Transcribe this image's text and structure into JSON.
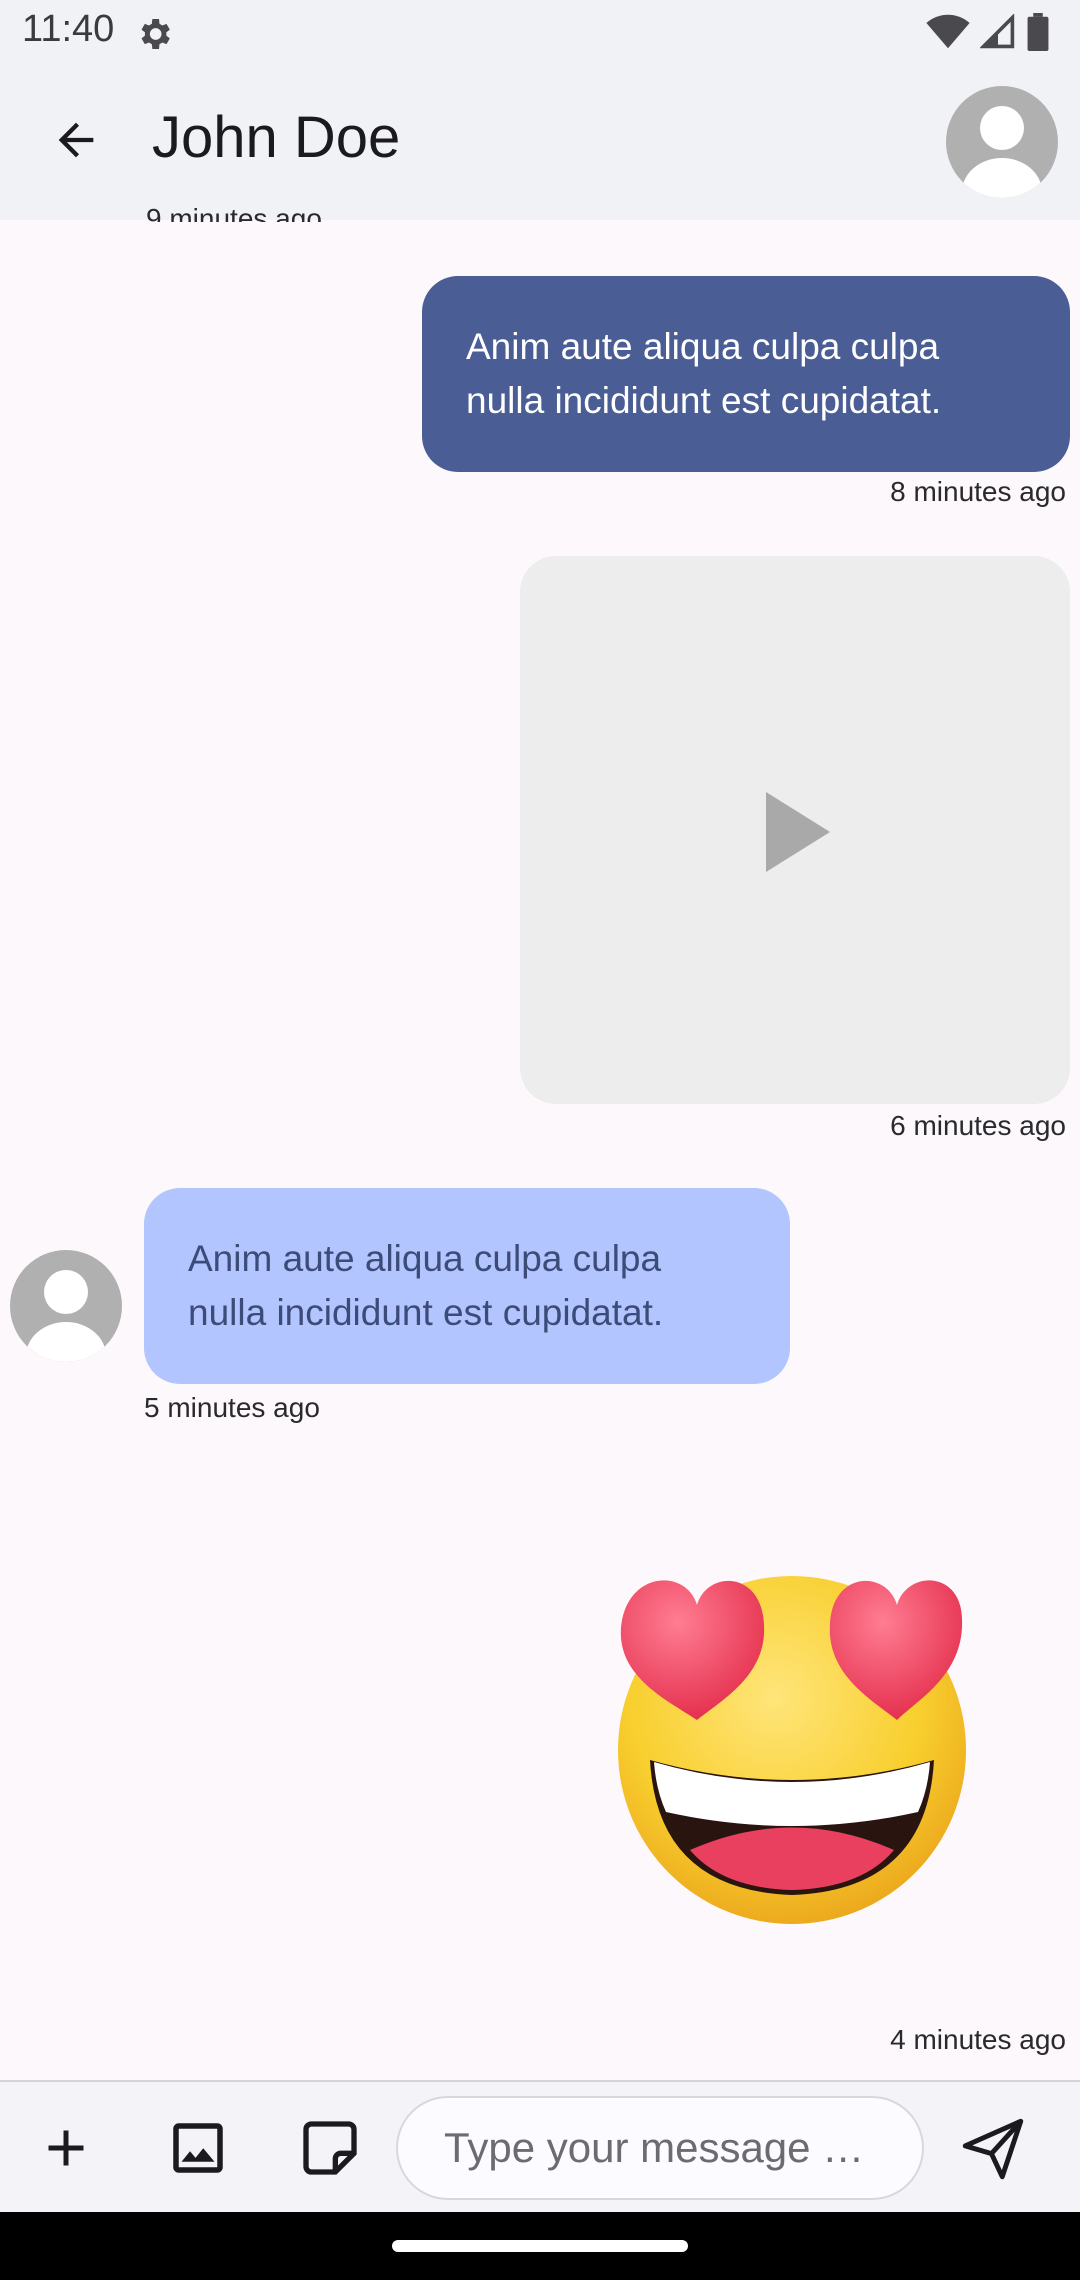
{
  "status_bar": {
    "time": "11:40",
    "icons": [
      "settings-icon",
      "wifi-icon",
      "signal-icon",
      "battery-icon"
    ]
  },
  "app_bar": {
    "title": "John Doe",
    "back_icon": "arrow-back-icon",
    "avatar_icon": "person-avatar-icon"
  },
  "messages": [
    {
      "direction": "outgoing",
      "type": "text",
      "text": "Anim aute aliqua culpa culpa nulla incididunt est cupidatat.",
      "time": "8 minutes ago"
    },
    {
      "direction": "outgoing",
      "type": "video",
      "time": "6 minutes ago"
    },
    {
      "direction": "incoming",
      "type": "text",
      "text": "Anim aute aliqua culpa culpa nulla incididunt est cupidatat.",
      "time": "5 minutes ago"
    },
    {
      "direction": "outgoing",
      "type": "sticker",
      "sticker": "heart-eyes-emoji",
      "time": "4 minutes ago"
    }
  ],
  "previous_time_clipped": "9 minutes ago",
  "composer": {
    "placeholder": "Type your message …",
    "buttons": [
      "add-icon",
      "image-icon",
      "sticker-icon"
    ],
    "send_icon": "send-icon"
  },
  "colors": {
    "outgoing_bubble": "#4a5d94",
    "incoming_bubble": "#b3c5ff",
    "incoming_text": "#3c4b77",
    "background": "#fcf8fc",
    "app_bar": "#f1f2f6"
  }
}
